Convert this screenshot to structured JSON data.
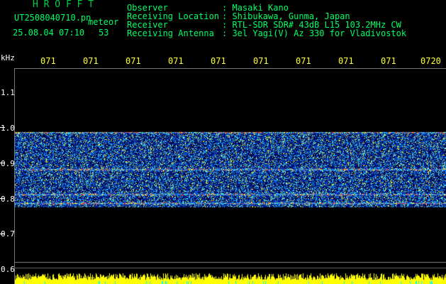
{
  "header": {
    "brand": "H R O F F T",
    "filename": "UT2508040710.pn",
    "meteor_label": "meteor",
    "datetime": "25.08.04 07:10",
    "count": "53",
    "info_labels": [
      "Observer",
      "Receiving Location",
      "Receiver",
      "Receiving Antenna"
    ],
    "info_values": [
      ": Masaki Kano",
      ": Shibukawa, Gunma, Japan",
      ": RTL-SDR SDR# 43dB L15 103.2MHz CW",
      ": 3el Yagi(V) Az 330 for Vladivostok"
    ]
  },
  "axes": {
    "y_unit": "kHz",
    "y_ticks": [
      "1.1",
      "1.0",
      "0.9",
      "0.8",
      "0.7",
      "0.6"
    ],
    "x_ticks": [
      "071",
      "071",
      "071",
      "071",
      "071",
      "071",
      "071",
      "071",
      "071",
      "0720"
    ]
  },
  "colors": {
    "background": "#000000",
    "header_text": "#00ff66",
    "x_tick_text": "#ffff33",
    "signal_band": "#ffffff",
    "noise_floor": "#ffff00"
  },
  "spectrogram": {
    "band_khz": [
      0.78,
      0.99
    ],
    "bright_lines_khz": [
      0.79,
      0.815,
      0.885,
      0.99
    ]
  }
}
